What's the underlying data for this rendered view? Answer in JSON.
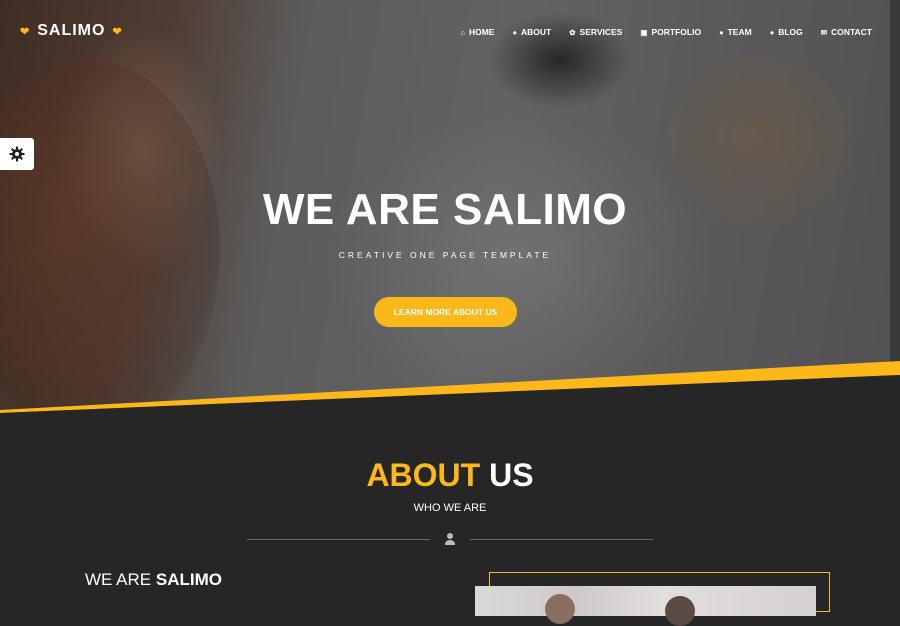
{
  "brand": {
    "name": "SALIMO",
    "heart_icon": "heart-icon",
    "accent": "#fcb719"
  },
  "nav": [
    {
      "label": "HOME",
      "icon": "home-icon",
      "glyph": "⌂"
    },
    {
      "label": "ABOUT",
      "icon": "user-icon",
      "glyph": "●"
    },
    {
      "label": "SERVICES",
      "icon": "gear-icon",
      "glyph": "✿"
    },
    {
      "label": "PORTFOLIO",
      "icon": "image-icon",
      "glyph": "▣"
    },
    {
      "label": "TEAM",
      "icon": "user-icon",
      "glyph": "●"
    },
    {
      "label": "BLOG",
      "icon": "comments-icon",
      "glyph": "●"
    },
    {
      "label": "CONTACT",
      "icon": "envelope-icon",
      "glyph": "✉"
    }
  ],
  "settings": {
    "icon": "gear-icon"
  },
  "hero": {
    "title": "WE ARE SALIMO",
    "subtitle": "CREATIVE ONE PAGE TEMPLATE",
    "button": "LEARN MORE ABOUT US"
  },
  "about": {
    "title_highlight": "ABOUT",
    "title_rest": " US",
    "subtitle": "WHO WE ARE",
    "divider_icon": "user-icon",
    "heading_light": "WE ARE ",
    "heading_bold": "SALIMO"
  }
}
